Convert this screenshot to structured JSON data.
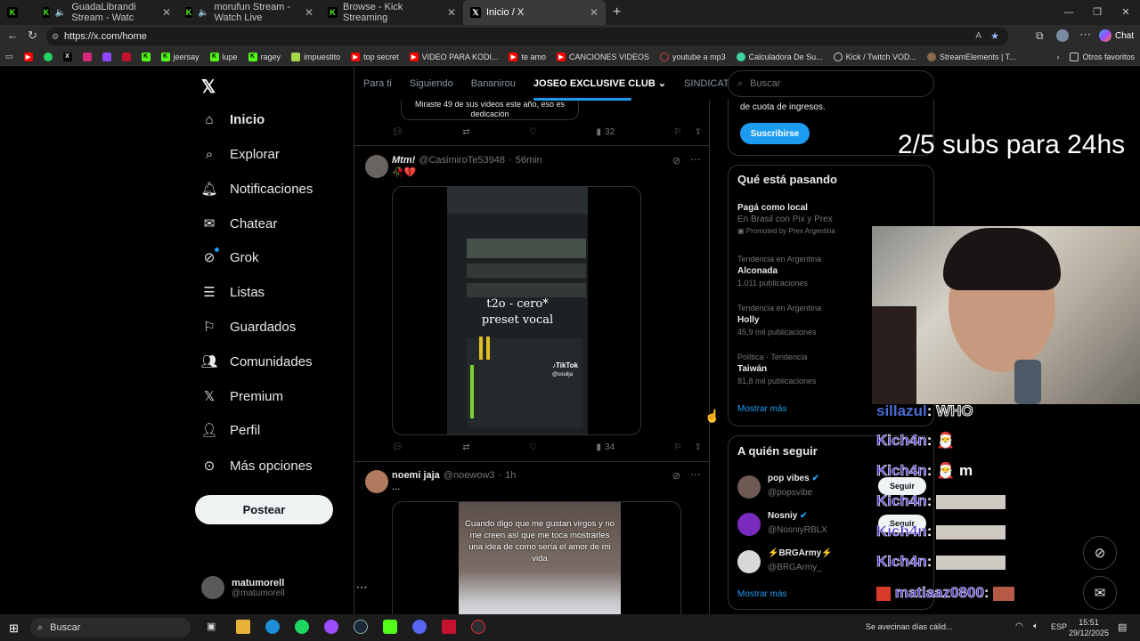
{
  "browser": {
    "tabs": [
      {
        "label": "",
        "icon": "kick-icon"
      },
      {
        "label": "GuadaLibrandi Stream - Watc",
        "icon": "kick-icon"
      },
      {
        "label": "morufun Stream - Watch Live",
        "icon": "kick-icon"
      },
      {
        "label": "Browse - Kick Streaming",
        "icon": "kick-icon"
      },
      {
        "label": "Inicio / X",
        "icon": "x-icon"
      }
    ],
    "url": "https://x.com/home",
    "bookmarks": [
      "jeersay",
      "lupe",
      "ragey",
      "impuestito",
      "top secret",
      "VIDEO PARA KODI...",
      "te amo",
      "CANCIONES VIDEOS",
      "youtube a mp3",
      "Calculadora De Su...",
      "Kick / Twitch VOD...",
      "StreamElements | T..."
    ],
    "other_bookmarks": "Otros favoritos"
  },
  "sidebar": {
    "items": [
      {
        "label": "Inicio",
        "icon": "home-icon"
      },
      {
        "label": "Explorar",
        "icon": "search-icon"
      },
      {
        "label": "Notificaciones",
        "icon": "bell-icon"
      },
      {
        "label": "Chatear",
        "icon": "mail-icon"
      },
      {
        "label": "Grok",
        "icon": "grok-icon"
      },
      {
        "label": "Listas",
        "icon": "list-icon"
      },
      {
        "label": "Guardados",
        "icon": "bookmark-icon"
      },
      {
        "label": "Comunidades",
        "icon": "communities-icon"
      },
      {
        "label": "Premium",
        "icon": "x-icon"
      },
      {
        "label": "Perfil",
        "icon": "person-icon"
      },
      {
        "label": "Más opciones",
        "icon": "more-icon"
      }
    ],
    "post_button": "Postear",
    "account": {
      "name": "matumorell",
      "handle": "@matumorell"
    }
  },
  "feed": {
    "tabs": [
      "Para ti",
      "Siguiendo",
      "Bananirou",
      "JOSEO EXCLUSIVE CLUB",
      "SINDICAT"
    ],
    "prev_tweet": {
      "text": "Miraste 49 de sus videos este año, eso es dedicación",
      "views": "32"
    },
    "tweet1": {
      "name": "Mtm!",
      "handle": "@CasimiroTe53948",
      "time": "56min",
      "emoji": "🥀💔",
      "video_caption_1": "t2o - cero*",
      "video_caption_2": "preset vocal",
      "watermark": "TikTok",
      "watermark_user": "@soulija",
      "views": "34"
    },
    "tweet2": {
      "name": "noemi jaja",
      "handle": "@noewow3",
      "time": "1h",
      "text": "...",
      "video_caption": "Cuando digo que me gustan virgos y no me creen así que me toca mostrarles una idea de como sería el amor de mi vida"
    }
  },
  "right": {
    "search_placeholder": "Buscar",
    "premium_text": "de cuota de ingresos.",
    "premium_button": "Suscribirse",
    "trends_title": "Qué está pasando",
    "trends": [
      {
        "title": "Pagá como local",
        "sub": "En Brasil con Pix y Prex",
        "meta": "Promoted by Prex Argentina"
      },
      {
        "context": "Tendencia en Argentina",
        "title": "Alconada",
        "meta": "1.011 publicaciones"
      },
      {
        "context": "Tendencia en Argentina",
        "title": "Holly",
        "meta": "45,9 mil publicaciones"
      },
      {
        "context": "Política · Tendencia",
        "title": "Taiwán",
        "meta": "81,8 mil publicaciones"
      }
    ],
    "show_more": "Mostrar más",
    "follow_title": "A quién seguir",
    "follow": [
      {
        "name": "pop vibes",
        "handle": "@popsvibe"
      },
      {
        "name": "Nosniy",
        "handle": "@NosniyRBLX"
      },
      {
        "name": "⚡BRGArmy⚡",
        "handle": "@BRGArmy_"
      }
    ],
    "follow_button": "Seguir",
    "follow_more": "Mostrar más"
  },
  "overlay": {
    "subs_goal": "2/5 subs para 24hs",
    "chat": [
      {
        "user": "sillazul",
        "msg": "WHO"
      },
      {
        "user": "Kich4n",
        "msg": ""
      },
      {
        "user": "Kich4n",
        "msg": "m"
      },
      {
        "user": "Kich4n",
        "msg": ""
      },
      {
        "user": "Kich4n",
        "msg": ""
      },
      {
        "user": "Kich4n",
        "msg": ""
      },
      {
        "user": "matiaaz0800",
        "msg": ""
      }
    ]
  },
  "taskbar": {
    "search": "Buscar",
    "weather": "Se avecinan días cálid...",
    "lang": "ESP",
    "time": "15:51",
    "date": "29/12/2025"
  }
}
